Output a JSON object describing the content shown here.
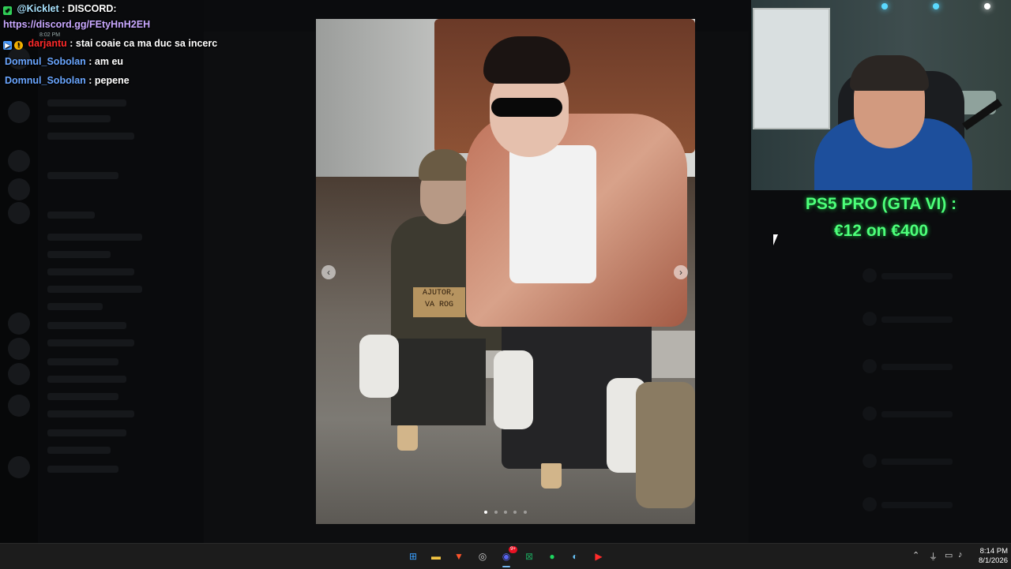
{
  "chat": {
    "lines": [
      {
        "badge": "✔",
        "badge_color": "#31d158",
        "user": "@Kicklet",
        "user_color": "#a9e3ff",
        "text": ": DISCORD:"
      },
      {
        "user": "",
        "user_color": "#c9a8ff",
        "text": "https://discord.gg/FEtyHnH2EH"
      },
      {
        "badge": "▶",
        "badge_color": "#4a9cff",
        "badge2": "!",
        "badge2_color": "#f5b200",
        "user": "darjantu",
        "user_color": "#ff2a2a",
        "text": ": stai coaie ca ma duc sa incerc"
      },
      {
        "user": "Domnul_Sobolan",
        "user_color": "#6aa6ff",
        "text": ": am eu"
      },
      {
        "user": "Domnul_Sobolan",
        "user_color": "#6aa6ff",
        "text": ": pepene"
      }
    ],
    "ghost_time": "8:02 PM"
  },
  "photo": {
    "sign_text_line1": "AJUTOR,",
    "sign_text_line2": "VA ROG",
    "prev_icon": "chevron-left-icon",
    "next_icon": "chevron-right-icon",
    "prev_glyph": "‹",
    "next_glyph": "›"
  },
  "promo": {
    "line1": "PS5 PRO (GTA VI) :",
    "line2": "€12 on €400",
    "color": "#4dff7a"
  },
  "taskbar": {
    "apps": [
      {
        "name": "windows-start-icon",
        "glyph": "⊞",
        "color": "#3aa0ff"
      },
      {
        "name": "file-explorer-icon",
        "glyph": "▬",
        "color": "#f4c542"
      },
      {
        "name": "brave-browser-icon",
        "glyph": "▼",
        "color": "#fb542b"
      },
      {
        "name": "obs-icon",
        "glyph": "◎",
        "color": "#cccccc"
      },
      {
        "name": "discord-icon",
        "glyph": "◉",
        "color": "#5865f2",
        "badge": "9+"
      },
      {
        "name": "excel-icon",
        "glyph": "⊠",
        "color": "#1d9e5a"
      },
      {
        "name": "spotify-icon",
        "glyph": "●",
        "color": "#1ed760"
      },
      {
        "name": "steam-icon",
        "glyph": "◐",
        "color": "#66c0f4"
      },
      {
        "name": "youtube-icon",
        "glyph": "▶",
        "color": "#ff2b2b"
      }
    ],
    "tray": [
      {
        "name": "chevron-up-icon",
        "glyph": "⌃"
      },
      {
        "name": "microphone-icon",
        "glyph": "⏚"
      },
      {
        "name": "network-icon",
        "glyph": "▭"
      },
      {
        "name": "volume-icon",
        "glyph": "♪"
      }
    ],
    "time": "8:14 PM",
    "date": "8/1/2026"
  }
}
